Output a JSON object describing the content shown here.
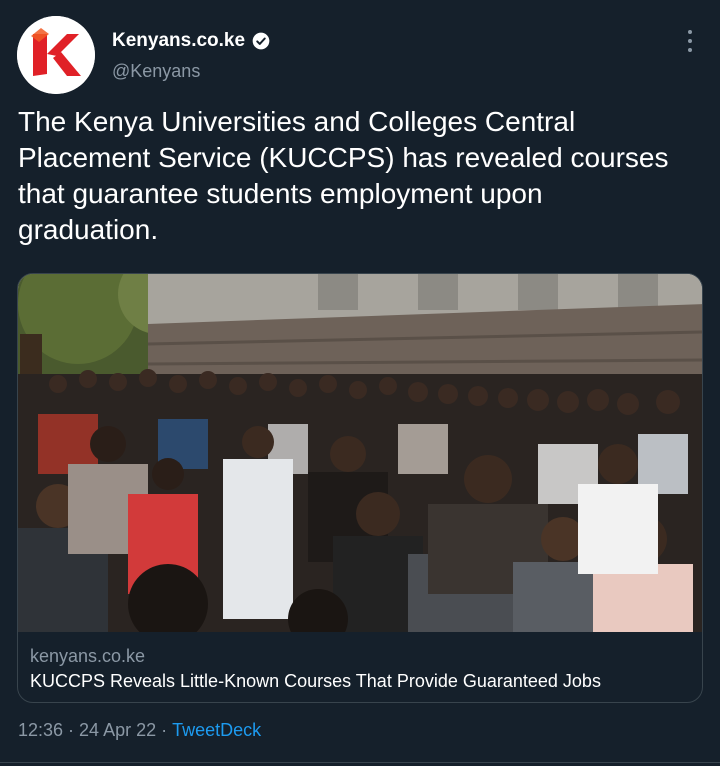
{
  "tweet": {
    "author": {
      "display_name": "Kenyans.co.ke",
      "handle": "@Kenyans",
      "verified": true,
      "avatar_letter": "K"
    },
    "text": "The Kenya Universities and Colleges Central\nPlacement Service (KUCCPS) has revealed courses\nthat guarantee students employment upon\ngraduation.",
    "card": {
      "domain": "kenyans.co.ke",
      "title": "KUCCPS Reveals Little-Known Courses That Provide Guaranteed Jobs"
    },
    "time": "12:36",
    "separator": " · ",
    "date": "24 Apr 22",
    "source": "TweetDeck"
  },
  "colors": {
    "background": "#15202b",
    "secondary_text": "#8b98a5",
    "link": "#1d9bf0",
    "brand_red": "#e02127"
  },
  "icons": [
    "verified-badge-icon",
    "more-options-icon"
  ]
}
